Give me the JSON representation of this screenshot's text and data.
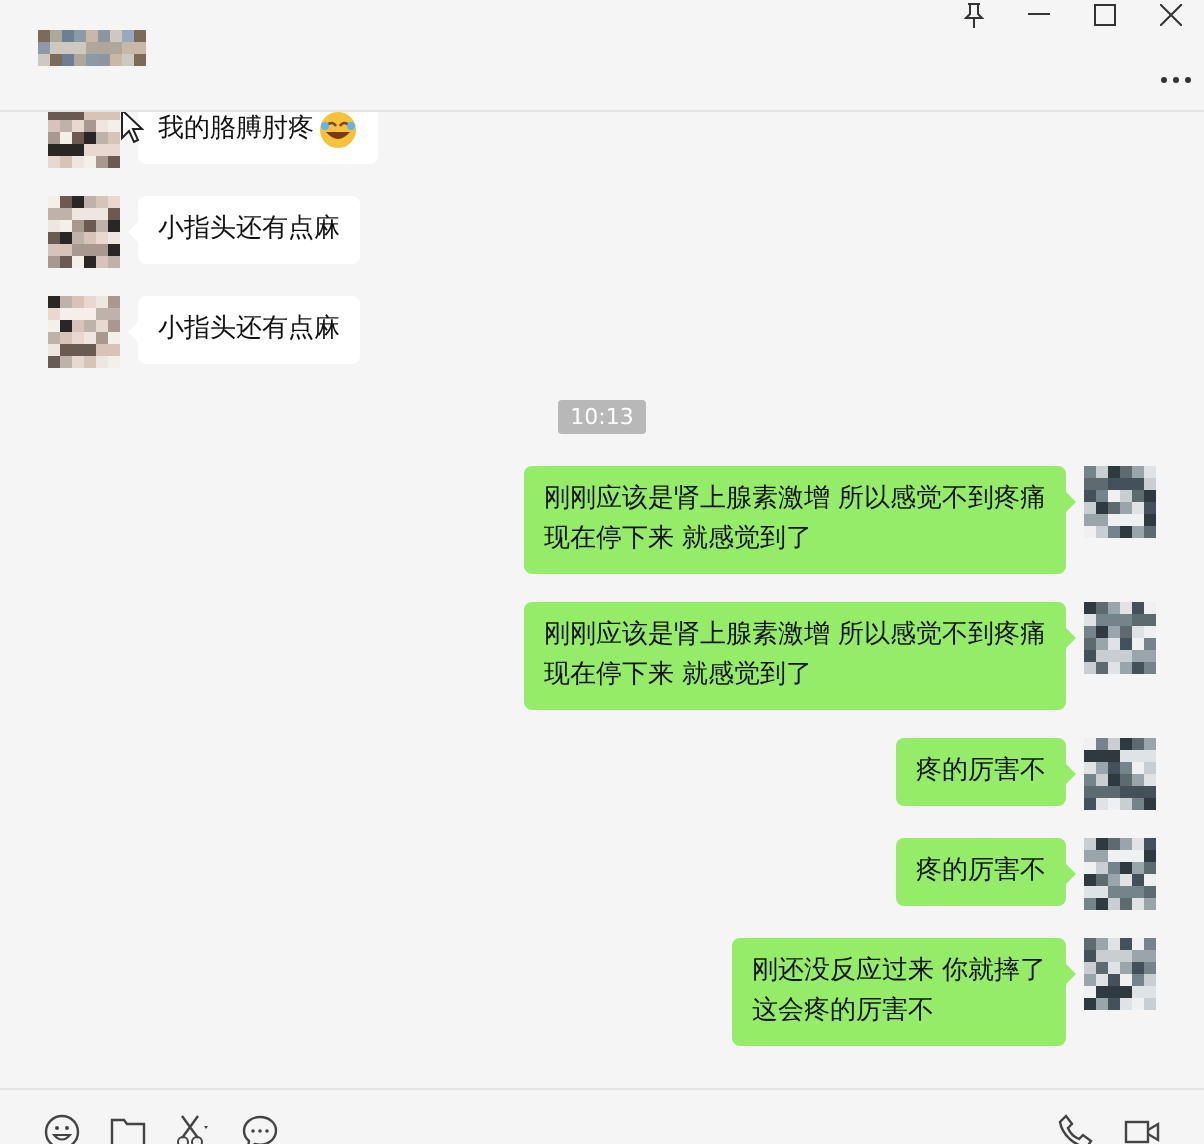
{
  "chat": {
    "messages": [
      {
        "kind": "text",
        "from_me": false,
        "lines": [
          "我的胳膊肘疼"
        ],
        "emoji": true
      },
      {
        "kind": "text",
        "from_me": false,
        "lines": [
          "小指头还有点麻"
        ]
      },
      {
        "kind": "text",
        "from_me": false,
        "lines": [
          "小指头还有点麻"
        ]
      },
      {
        "kind": "time",
        "text": "10:13"
      },
      {
        "kind": "text",
        "from_me": true,
        "lines": [
          "刚刚应该是肾上腺素激增 所以感觉不到疼痛",
          "现在停下来 就感觉到了"
        ]
      },
      {
        "kind": "text",
        "from_me": true,
        "lines": [
          "刚刚应该是肾上腺素激增 所以感觉不到疼痛",
          "现在停下来 就感觉到了"
        ]
      },
      {
        "kind": "text",
        "from_me": true,
        "lines": [
          "疼的厉害不"
        ]
      },
      {
        "kind": "text",
        "from_me": true,
        "lines": [
          "疼的厉害不"
        ]
      },
      {
        "kind": "text",
        "from_me": true,
        "lines": [
          "刚还没反应过来 你就摔了",
          "这会疼的厉害不"
        ]
      }
    ]
  }
}
